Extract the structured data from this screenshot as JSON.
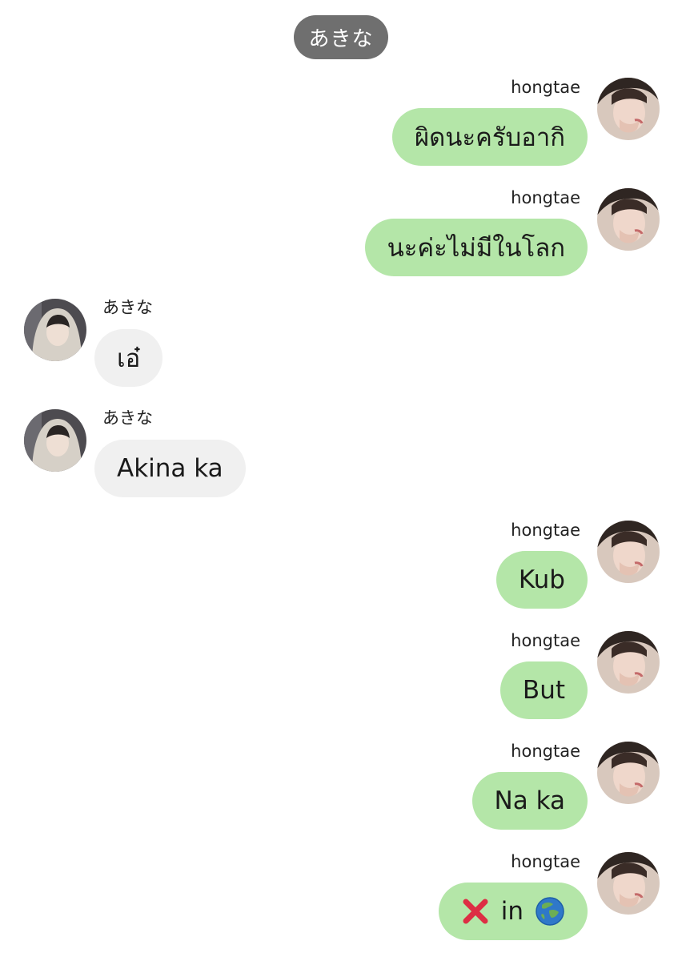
{
  "header": {
    "title": "あきな"
  },
  "contacts": {
    "me": "hongtae",
    "other": "あきな"
  },
  "colors": {
    "outgoing_bubble": "#b4e6a8",
    "incoming_bubble": "#f0f0f0",
    "header_pill": "#6f6f6f"
  },
  "messages": [
    {
      "sender": "hongtae",
      "direction": "outgoing",
      "text": "ผิดนะครับอากิ"
    },
    {
      "sender": "hongtae",
      "direction": "outgoing",
      "text": "นะค่ะไม่มีในโลก"
    },
    {
      "sender": "あきな",
      "direction": "incoming",
      "text": "เอ๋"
    },
    {
      "sender": "あきな",
      "direction": "incoming",
      "text": "Akina ka"
    },
    {
      "sender": "hongtae",
      "direction": "outgoing",
      "text": "Kub"
    },
    {
      "sender": "hongtae",
      "direction": "outgoing",
      "text": "But"
    },
    {
      "sender": "hongtae",
      "direction": "outgoing",
      "text": "Na ka"
    },
    {
      "sender": "hongtae",
      "direction": "outgoing",
      "text": "in",
      "icons": [
        "cross-mark-icon",
        "globe-icon"
      ]
    }
  ]
}
